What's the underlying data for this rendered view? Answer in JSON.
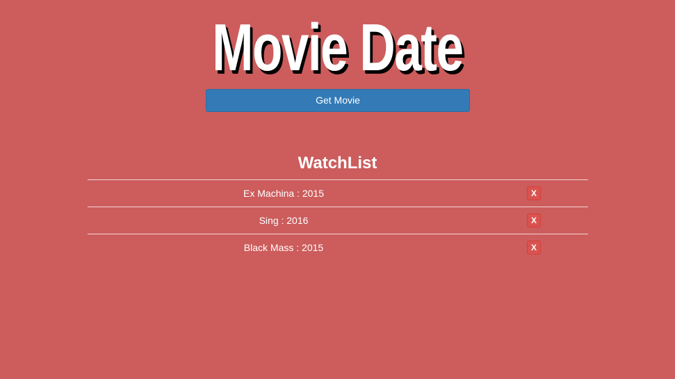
{
  "header": {
    "title": "Movie Date",
    "get_movie_label": "Get Movie"
  },
  "watchlist": {
    "heading": "WatchList",
    "items": [
      {
        "label": "Ex Machina : 2015",
        "remove_label": "X"
      },
      {
        "label": "Sing : 2016",
        "remove_label": "X"
      },
      {
        "label": "Black Mass : 2015",
        "remove_label": "X"
      }
    ]
  },
  "colors": {
    "background": "#cd5c5c",
    "primary_button": "#337ab7",
    "danger_button": "#d9534f",
    "text": "#ffffff",
    "title_shadow": "#000000"
  }
}
